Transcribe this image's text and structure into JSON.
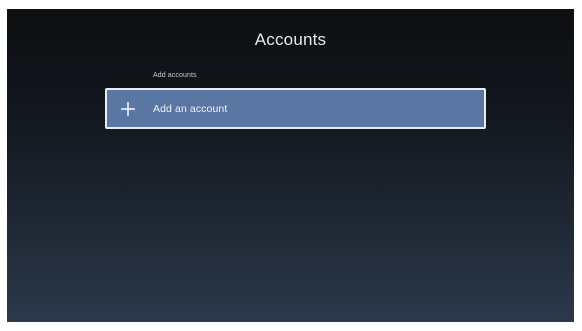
{
  "screen": {
    "title": "Accounts"
  },
  "section": {
    "label": "Add accounts"
  },
  "add_account": {
    "label": "Add an account",
    "icon": "plus-icon"
  },
  "colors": {
    "row_fill": "#5a76a3",
    "row_border": "#e9ecf2",
    "background_top": "#0d0f11",
    "background_bottom": "#2c394b"
  }
}
